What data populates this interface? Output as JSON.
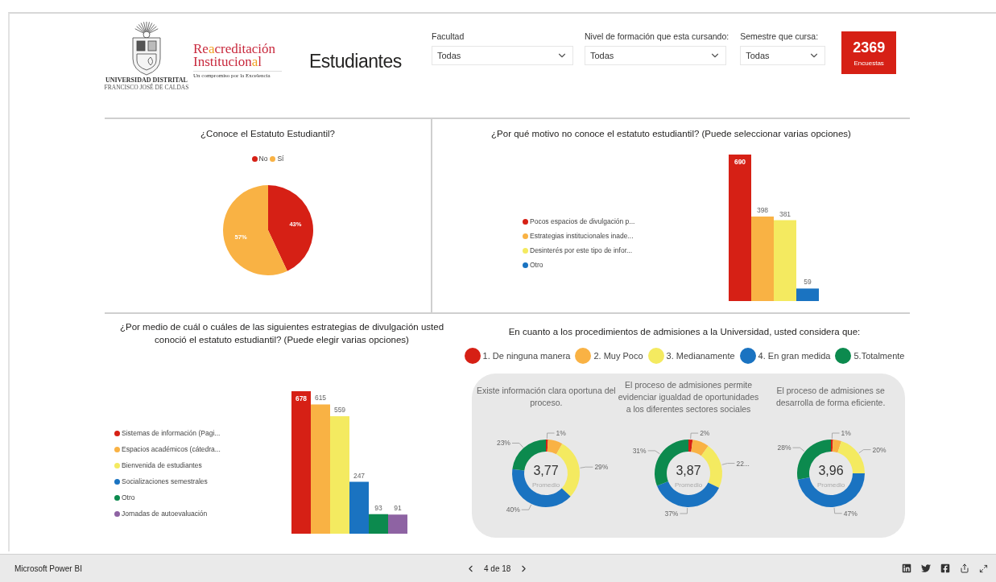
{
  "header": {
    "university": {
      "name": "UNIVERSIDAD DISTRITAL",
      "subtitle": "FRANCISCO JOSÉ DE CALDAS"
    },
    "accreditation": {
      "line1": [
        {
          "text": "Re",
          "accent": false
        },
        {
          "text": "a",
          "accent": true
        },
        {
          "text": "creditación",
          "accent": false
        }
      ],
      "line2": [
        {
          "text": "Institucion",
          "accent": false
        },
        {
          "text": "a",
          "accent": true
        },
        {
          "text": "l",
          "accent": false
        }
      ],
      "tagline": "Un compromiso por la Excelencia"
    },
    "page_title": "Estudiantes",
    "slicers": [
      {
        "label": "Facultad",
        "value": "Todas"
      },
      {
        "label": "Nivel de formación que esta cursando:",
        "value": "Todas"
      },
      {
        "label": "Semestre que cursa:",
        "value": "Todas"
      }
    ],
    "kpi": {
      "value": "2369",
      "label": "Encuestas"
    }
  },
  "knows_statute": {
    "legend": [
      {
        "label": "No",
        "color": "#d62015"
      },
      {
        "label": "Sí",
        "color": "#f9b244"
      }
    ],
    "chart_data": {
      "type": "pie",
      "title": "¿Conoce el Estatuto Estudiantil?",
      "values": [
        43,
        57
      ],
      "value_labels": [
        "43%",
        "57%"
      ]
    }
  },
  "reasons": {
    "chart_data": {
      "type": "bar",
      "title": "¿Por qué motivo no conoce el estatuto estudiantil? (Puede seleccionar varias opciones)",
      "data_labels": true,
      "series": [
        {
          "name": "Pocos espacios de divulgación p...",
          "color": "#d62015",
          "values": [
            690
          ]
        },
        {
          "name": "Estrategias institucionales inade...",
          "color": "#f9b244",
          "values": [
            398
          ]
        },
        {
          "name": "Desinterés por este tipo de infor...",
          "color": "#f4ea60",
          "values": [
            381
          ]
        },
        {
          "name": "Otro",
          "color": "#1a73c1",
          "values": [
            59
          ]
        }
      ]
    }
  },
  "strategies": {
    "chart_data": {
      "type": "bar",
      "title": "¿Por medio de cuál o cuáles de las siguientes estrategias de divulgación usted conoció el estatuto estudiantil? (Puede elegir varias opciones)",
      "data_labels": true,
      "series": [
        {
          "name": "Sistemas de información (Pagi...",
          "color": "#d62015",
          "values": [
            678
          ]
        },
        {
          "name": "Espacios académicos (cátedra...",
          "color": "#f9b244",
          "values": [
            615
          ]
        },
        {
          "name": "Bienvenida de estudiantes",
          "color": "#f4ea60",
          "values": [
            559
          ]
        },
        {
          "name": "Socializaciones semestrales",
          "color": "#1a73c1",
          "values": [
            247
          ]
        },
        {
          "name": "Otro",
          "color": "#0c8a4e",
          "values": [
            93
          ]
        },
        {
          "name": "Jornadas de autoevaluación",
          "color": "#8e63a3",
          "values": [
            91
          ]
        }
      ]
    }
  },
  "admissions": {
    "title": "En cuanto a los procedimientos de admisiones a la Universidad, usted considera que:",
    "legend": [
      {
        "label": "1. De ninguna manera",
        "color": "#d62015"
      },
      {
        "label": "2. Muy Poco",
        "color": "#f9b244"
      },
      {
        "label": "3. Medianamente",
        "color": "#f4ea60"
      },
      {
        "label": "4. En gran medida",
        "color": "#1a73c1"
      },
      {
        "label": "5.Totalmente",
        "color": "#0c8a4e"
      }
    ],
    "donuts": [
      {
        "average": "3,77",
        "average_label": "Promedio",
        "chart_data": {
          "type": "donut",
          "title": "Existe información clara oportuna del proceso.",
          "values": [
            1,
            7,
            29,
            40,
            23
          ],
          "value_labels": [
            "1%",
            null,
            "29%",
            "40%",
            "23%"
          ]
        }
      },
      {
        "average": "3,87",
        "average_label": "Promedio",
        "chart_data": {
          "type": "donut",
          "title": "El proceso de admisiones permite evidenciar igualdad de oportunidades a los diferentes sectores sociales",
          "values": [
            2,
            8,
            22,
            37,
            31
          ],
          "value_labels": [
            "2%",
            null,
            "22...",
            "37%",
            "31%"
          ]
        }
      },
      {
        "average": "3,96",
        "average_label": "Promedio",
        "chart_data": {
          "type": "donut",
          "title": "El proceso de admisiones se desarrolla de forma eficiente.",
          "values": [
            1,
            4,
            20,
            47,
            28
          ],
          "value_labels": [
            "1%",
            null,
            "20%",
            "47%",
            "28%"
          ]
        }
      }
    ]
  },
  "footer": {
    "brand": "Microsoft Power BI",
    "page_indicator": "4 de 18"
  }
}
